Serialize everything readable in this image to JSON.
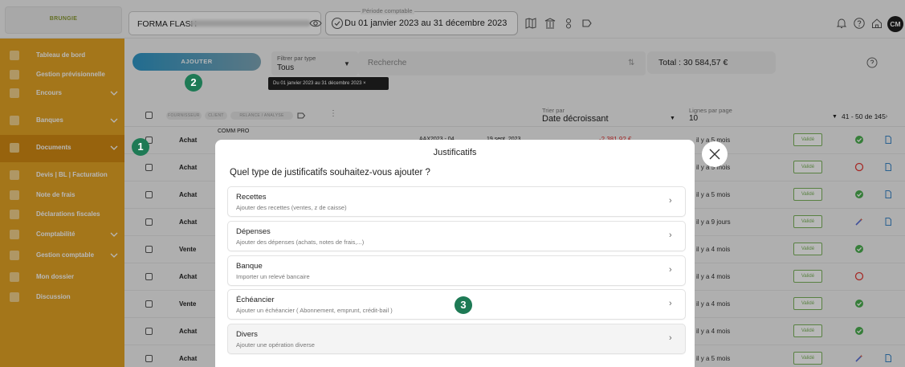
{
  "topbar": {
    "logo": "BRUNGIE",
    "company_name": "FORMA FLASH",
    "period_label": "Période comptable",
    "period_value": "Du 01 janvier 2023 au 31 décembre 2023",
    "avatar": "CM"
  },
  "sidebar": {
    "items": [
      {
        "label": "Tableau de bord",
        "chevron": false
      },
      {
        "label": "Gestion prévisionnelle",
        "chevron": false
      },
      {
        "label": "Encours",
        "chevron": true
      },
      {
        "label": "Banques",
        "chevron": true
      },
      {
        "label": "Documents",
        "chevron": true
      },
      {
        "label": "Devis | BL | Facturation",
        "chevron": false
      },
      {
        "label": "Note de frais",
        "chevron": false
      },
      {
        "label": "Déclarations fiscales",
        "chevron": false
      },
      {
        "label": "Comptabilité",
        "chevron": true
      },
      {
        "label": "Gestion comptable",
        "chevron": true
      },
      {
        "label": "Mon dossier",
        "chevron": false
      },
      {
        "label": "Discussion",
        "chevron": false
      }
    ]
  },
  "toolbar": {
    "add_label": "AJOUTER",
    "filter_label": "Filtrer par type",
    "filter_value": "Tous",
    "search_placeholder": "Recherche",
    "total": "Total : 30 584,57 €",
    "period_tooltip": "Du 01 janvier 2023 au 31 décembre 2023 ×"
  },
  "list_header": {
    "chips": [
      "FOURNISSEUR",
      "CLIENT",
      "RELANCE / ANALYSE"
    ],
    "sort_label": "Trier par",
    "sort_value": "Date décroissant",
    "lines_label": "Lignes par page",
    "lines_value": "10",
    "pagination": "41 - 50 de 145"
  },
  "rows": [
    {
      "type": "Achat",
      "date": "il y a 5 mois",
      "status": "validated",
      "badge": "Validé"
    },
    {
      "type": "Achat",
      "date": "il y a 5 mois",
      "status": "pending",
      "badge": "Validé"
    },
    {
      "type": "Achat",
      "date": "il y a 5 mois",
      "status": "validated",
      "badge": "Validé"
    },
    {
      "type": "Achat",
      "date": "il y a 9 jours",
      "status": "magic",
      "badge": "Validé"
    },
    {
      "type": "Vente",
      "date": "il y a 4 mois",
      "status": "validated",
      "badge": "Validé"
    },
    {
      "type": "Achat",
      "date": "il y a 4 mois",
      "status": "pending",
      "badge": "Validé"
    },
    {
      "type": "Vente",
      "date": "il y a 4 mois",
      "status": "validated",
      "badge": "Validé"
    },
    {
      "type": "Achat",
      "date": "il y a 4 mois",
      "status": "validated",
      "badge": "Validé"
    },
    {
      "type": "Achat",
      "date": "il y a 5 mois",
      "status": "magic",
      "badge": "Validé"
    }
  ],
  "row1_extra": {
    "label": "COMM PRO",
    "ref": "AAX2023 - 04",
    "date2": "19 sept. 2023",
    "amount": "-2 381,92 €"
  },
  "modal": {
    "title": "Justificatifs",
    "question": "Quel type de justificatifs souhaitez-vous ajouter ?",
    "options": [
      {
        "title": "Recettes",
        "desc": "Ajouter des recettes (ventes, z de caisse)"
      },
      {
        "title": "Dépenses",
        "desc": "Ajouter des dépenses (achats, notes de frais,...)"
      },
      {
        "title": "Banque",
        "desc": "Importer un relevé bancaire"
      },
      {
        "title": "Échéancier",
        "desc": "Ajouter un échéancier ( Abonnement, emprunt, crédit-bail )"
      },
      {
        "title": "Divers",
        "desc": "Ajouter une opération diverse"
      }
    ]
  },
  "steps": [
    "1",
    "2",
    "3"
  ],
  "colors": {
    "sidebar": "#e3a424",
    "accent": "#2f97c7",
    "validated": "#4caf50",
    "pending": "#e53935",
    "step": "#1e7a55"
  }
}
